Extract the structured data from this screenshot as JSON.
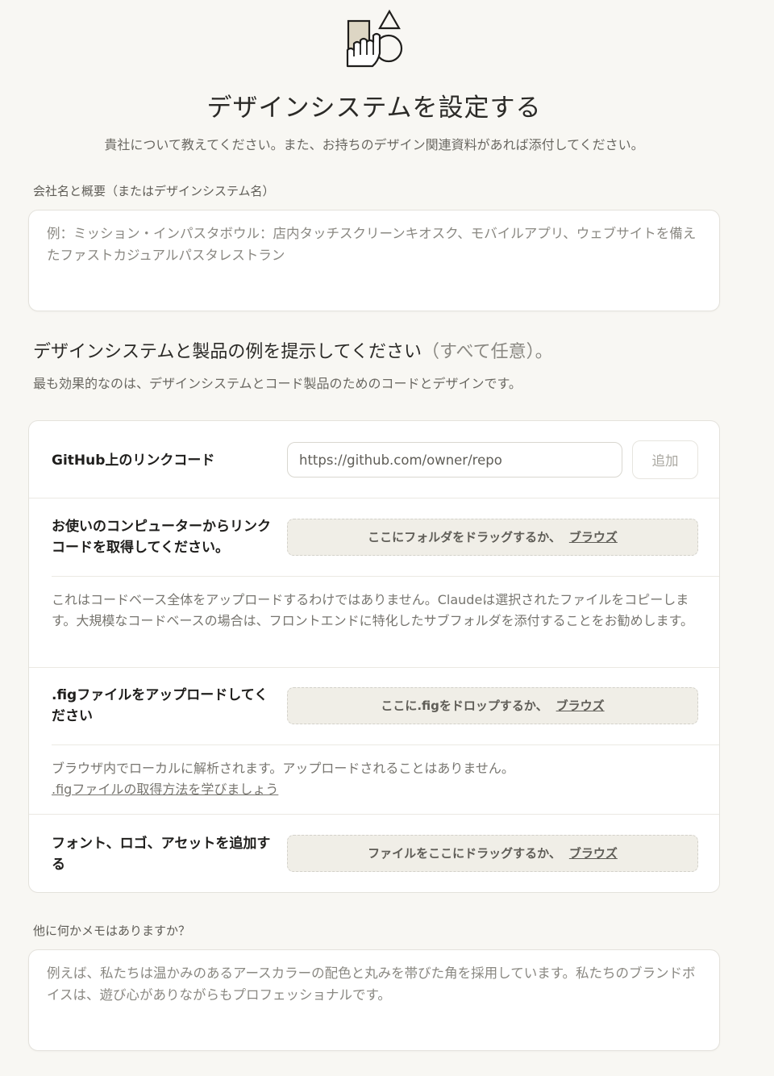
{
  "header": {
    "title": "デザインシステムを設定する",
    "subtitle": "貴社について教えてください。また、お持ちのデザイン関連資料があれば添付してください。"
  },
  "company": {
    "label": "会社名と概要（またはデザインシステム名）",
    "placeholder": "例：ミッション・インパスタボウル：店内タッチスクリーンキオスク、モバイルアプリ、ウェブサイトを備えたファストカジュアルパスタレストラン"
  },
  "examples": {
    "heading": "デザインシステムと製品の例を提示してください",
    "heading_optional": "（すべて任意）。",
    "description": "最も効果的なのは、デザインシステムとコード製品のためのコードとデザインです。",
    "github": {
      "label": "GitHub上のリンクコード",
      "input_value": "https://github.com/owner/repo",
      "add_label": "追加"
    },
    "local": {
      "label": "お使いのコンピューターからリンクコードを取得してください。",
      "drop_text": "ここにフォルダをドラッグするか、",
      "browse_label": "ブラウズ",
      "help": "これはコードベース全体をアップロードするわけではありません。Claudeは選択されたファイルをコピーします。大規模なコードベースの場合は、フロントエンドに特化したサブフォルダを添付することをお勧めします。"
    },
    "fig": {
      "label": ".figファイルをアップロードしてください",
      "drop_text": "ここに.figをドロップするか、",
      "browse_label": "ブラウズ",
      "help": "ブラウザ内でローカルに解析されます。アップロードされることはありません。",
      "help_link": ".figファイルの取得方法を学びましょう"
    },
    "assets": {
      "label": "フォント、ロゴ、アセットを追加する",
      "drop_text": "ファイルをここにドラッグするか、",
      "browse_label": "ブラウズ"
    }
  },
  "notes": {
    "label": "他に何かメモはありますか？",
    "placeholder": "例えば、私たちは温かみのあるアースカラーの配色と丸みを帯びた角を採用しています。私たちのブランドボイスは、遊び心がありながらもプロフェッショナルです。"
  },
  "logo_icon": "shapes-hand-icon"
}
